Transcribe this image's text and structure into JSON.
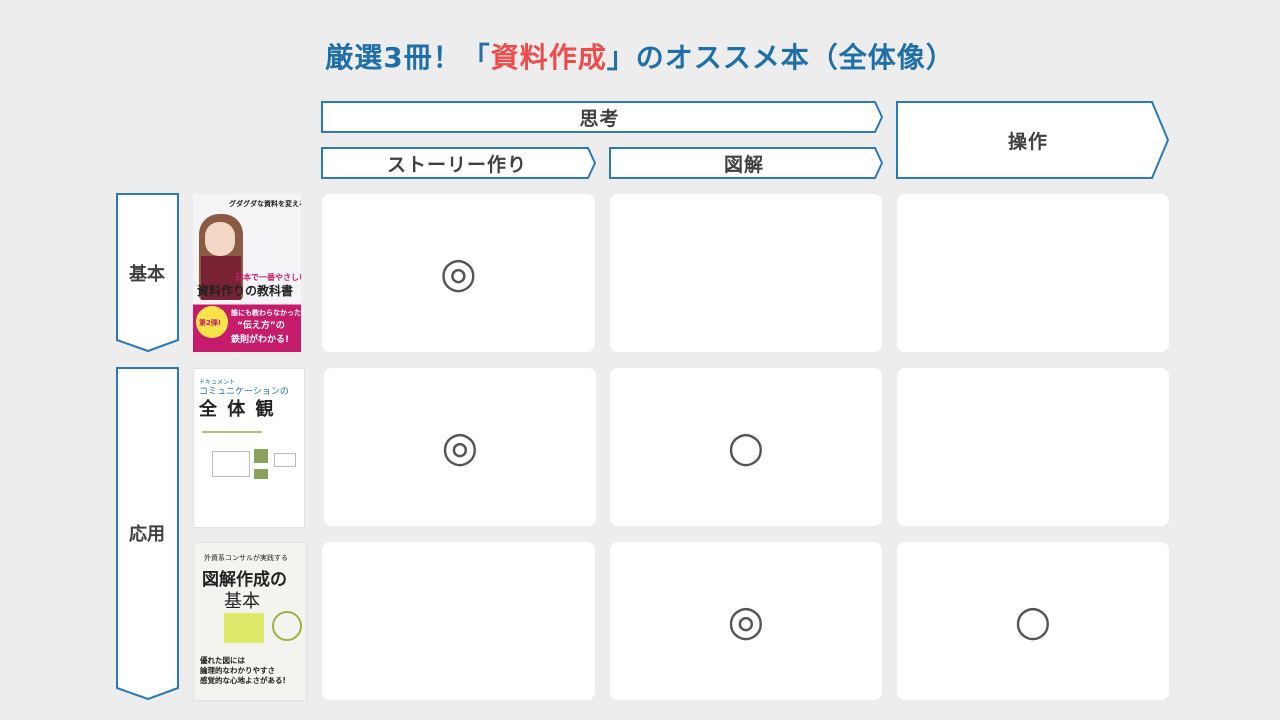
{
  "title": {
    "before": "厳選3冊！「",
    "accent": "資料作成",
    "after": "」のオススメ本（全体像）"
  },
  "headers": {
    "thinking": "思考",
    "story": "ストーリー作り",
    "diagram": "図解",
    "operation": "操作"
  },
  "rows": {
    "basic": "基本",
    "applied": "応用"
  },
  "marks": {
    "r1": {
      "story": "◎",
      "diagram": "",
      "operation": ""
    },
    "r2": {
      "story": "◎",
      "diagram": "○",
      "operation": ""
    },
    "r3": {
      "story": "",
      "diagram": "◎",
      "operation": "○"
    }
  },
  "books": {
    "b1": {
      "top": "グダグダな資料を変える!",
      "sub1": "日本で一番やさしい",
      "main": "資料作りの教科書",
      "band1": "誰にも教わらなかった",
      "band2": "“伝え方”の",
      "band3": "鉄則がわかる!",
      "badge": "第2弾!"
    },
    "b2": {
      "line1": "ドキュメント",
      "line2": "コミュニケーションの",
      "main": "全 体 観"
    },
    "b3": {
      "top": "外資系コンサルが実践する",
      "main1": "図解作成の",
      "main2": "基本",
      "desc1": "優れた図には",
      "desc2": "論理的なわかりやすさ",
      "desc3": "感覚的な心地よさがある!"
    }
  },
  "colors": {
    "brand": "#1f6fa8",
    "accent": "#f04b4b",
    "background": "#ededed"
  }
}
